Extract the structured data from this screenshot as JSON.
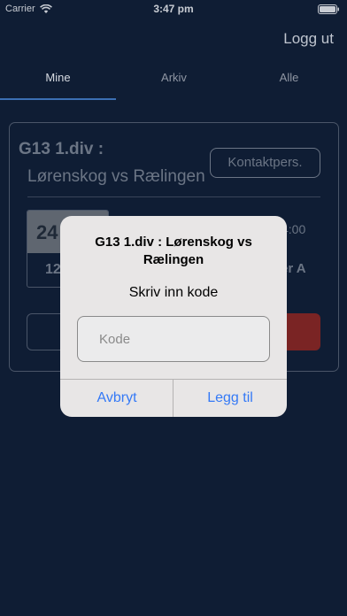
{
  "status_bar": {
    "carrier": "Carrier",
    "time": "3:47 pm",
    "icons": [
      "wifi-icon",
      "battery-icon"
    ]
  },
  "header": {
    "logout_label": "Logg ut"
  },
  "tabs": [
    {
      "label": "Mine",
      "selected": true
    },
    {
      "label": "Arkiv",
      "selected": false
    },
    {
      "label": "Alle",
      "selected": false
    }
  ],
  "match_card": {
    "title": "G13 1.div :",
    "teams": "Lørenskog vs Rælingen",
    "contact_button": "Kontaktpers.",
    "date_day": "24",
    "date_month": "12",
    "time_partial": "4:00",
    "place_partial": "er A"
  },
  "dialog": {
    "title": "G13 1.div : Lørenskog vs Rælingen",
    "message": "Skriv inn kode",
    "input_placeholder": "Kode",
    "input_value": "",
    "cancel_label": "Avbryt",
    "add_label": "Legg til"
  },
  "colors": {
    "background": "#0f1d34",
    "accent": "#3b6fb3",
    "dialog_button": "#3479f6",
    "danger": "#7a2424"
  }
}
